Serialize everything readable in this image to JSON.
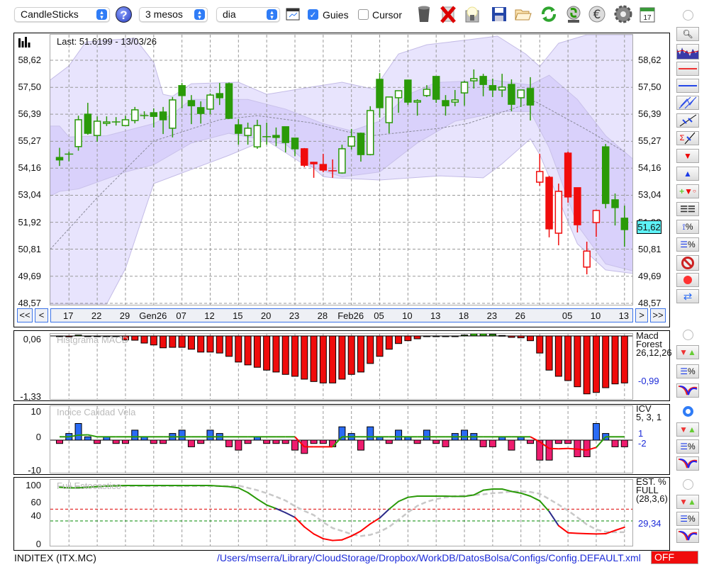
{
  "toolbar": {
    "chart_type": "CandleSticks",
    "help": "?",
    "period": "3 mesos",
    "interval": "dia",
    "guides_label": "Guies",
    "guides_checked": true,
    "cursor_label": "Cursor",
    "cursor_checked": false,
    "icons": [
      "chart-settings-icon",
      "trash-icon",
      "delete-icon",
      "lamp-icon",
      "save-icon",
      "folder-icon",
      "refresh-icon",
      "recycle-icon",
      "euro-icon",
      "gear-icon",
      "calendar-icon"
    ],
    "calendar_day": "17"
  },
  "main": {
    "last_label": "Last: 51.6199 - 13/03/26",
    "current_price": "51,62",
    "nav": {
      "first": "<<",
      "prev": "<",
      "next": ">",
      "last": ">>"
    }
  },
  "panels": {
    "macd": {
      "title": "Histgrama MACD",
      "name1": "Macd",
      "name2": "Forest",
      "name3": "26,12,26",
      "value": "-0,99",
      "ymax": "0,06",
      "ymin": "-1,33"
    },
    "icv": {
      "title": "Indice Calidad Vela",
      "name1": "ICV",
      "name2": "5, 3, 1",
      "value1": "1",
      "value2": "-2",
      "ymax": "10",
      "yzero": "0",
      "ymin": "-10"
    },
    "stoch": {
      "title": "Full Estocastico",
      "name1": "EST. %",
      "name2": "FULL",
      "name3": "(28,3,6)",
      "value": "29,34",
      "y100": "100",
      "y60": "60",
      "y40": "40",
      "y0": "0"
    }
  },
  "status": {
    "symbol": "INDITEX (ITX.MC)",
    "path": "/Users/mserra/Library/CloudStorage/Dropbox/WorkDB/DatosBolsa/Configs/Config.DEFAULT.xml",
    "toggle": "OFF"
  },
  "colors": {
    "up": "#2a9a08",
    "down_red": "#f00c0c",
    "macd_neg": "#f00c0c",
    "macd_pos": "#2a9a08",
    "icv_pos": "#2a6bf5",
    "icv_neg": "#ee1c6e",
    "accent": "#2f7cf6",
    "price_box": "#5ef2f6",
    "path": "#1c2bd8"
  },
  "chart_data": {
    "main": {
      "type": "candlestick",
      "ylim": [
        48.57,
        58.62
      ],
      "y_ticks": [
        {
          "v": 58.62,
          "label": "58,62"
        },
        {
          "v": 57.5,
          "label": "57,50"
        },
        {
          "v": 56.39,
          "label": "56,39"
        },
        {
          "v": 55.27,
          "label": "55,27"
        },
        {
          "v": 54.16,
          "label": "54,16"
        },
        {
          "v": 53.04,
          "label": "53,04"
        },
        {
          "v": 51.92,
          "label": "51,92"
        },
        {
          "v": 50.81,
          "label": "50,81"
        },
        {
          "v": 49.69,
          "label": "49,69"
        },
        {
          "v": 48.57,
          "label": "48,57"
        }
      ],
      "x_labels": [
        {
          "i": 1,
          "label": "17"
        },
        {
          "i": 4,
          "label": "22"
        },
        {
          "i": 7,
          "label": "29"
        },
        {
          "i": 10,
          "label": "Gen26"
        },
        {
          "i": 13,
          "label": "07"
        },
        {
          "i": 16,
          "label": "12"
        },
        {
          "i": 19,
          "label": "15"
        },
        {
          "i": 22,
          "label": "20"
        },
        {
          "i": 25,
          "label": "23"
        },
        {
          "i": 28,
          "label": "28"
        },
        {
          "i": 31,
          "label": "Feb26"
        },
        {
          "i": 34,
          "label": "05"
        },
        {
          "i": 37,
          "label": "10"
        },
        {
          "i": 40,
          "label": "13"
        },
        {
          "i": 43,
          "label": "18"
        },
        {
          "i": 46,
          "label": "23"
        },
        {
          "i": 49,
          "label": "26"
        },
        {
          "i": 54,
          "label": "05"
        },
        {
          "i": 57,
          "label": "10"
        },
        {
          "i": 60,
          "label": "13"
        }
      ],
      "grid_x": [
        1,
        4,
        7,
        10,
        13,
        16,
        19,
        22,
        25,
        28,
        31,
        34,
        37,
        40,
        43,
        46,
        49,
        51,
        54,
        57,
        60
      ],
      "candles_ohlc_color": [
        [
          54.6,
          55.0,
          54.25,
          54.5,
          "g"
        ],
        [
          54.74,
          54.84,
          54.44,
          54.74,
          "g"
        ],
        [
          55.05,
          56.33,
          54.88,
          56.16,
          "g"
        ],
        [
          56.39,
          56.86,
          55.54,
          55.6,
          "g"
        ],
        [
          55.51,
          56.3,
          55.25,
          56.1,
          "g"
        ],
        [
          56.01,
          56.3,
          55.9,
          56.07,
          "g"
        ],
        [
          56.07,
          56.27,
          55.92,
          56.07,
          "g"
        ],
        [
          55.92,
          56.33,
          55.92,
          56.16,
          "g"
        ],
        [
          56.13,
          56.69,
          56.01,
          56.57,
          "g"
        ],
        [
          56.33,
          56.51,
          56.19,
          56.33,
          "g"
        ],
        [
          56.45,
          56.63,
          55.84,
          56.3,
          "g"
        ],
        [
          56.48,
          56.69,
          55.57,
          56.16,
          "g"
        ],
        [
          55.81,
          57.1,
          55.43,
          56.98,
          "g"
        ],
        [
          57.57,
          57.68,
          56.63,
          57.16,
          "g"
        ],
        [
          56.95,
          57.18,
          55.98,
          56.74,
          "g"
        ],
        [
          56.66,
          56.92,
          56.0,
          56.42,
          "g"
        ],
        [
          56.6,
          57.25,
          56.39,
          57.18,
          "g"
        ],
        [
          57.24,
          57.68,
          56.77,
          57.07,
          "g"
        ],
        [
          57.65,
          57.7,
          56.19,
          56.22,
          "g"
        ],
        [
          55.95,
          56.19,
          55.13,
          55.6,
          "g"
        ],
        [
          55.51,
          56.04,
          55.13,
          55.81,
          "g"
        ],
        [
          55.04,
          56.16,
          54.96,
          55.92,
          "g"
        ],
        [
          55.46,
          56.04,
          55.13,
          55.46,
          "g"
        ],
        [
          55.51,
          55.84,
          55.07,
          55.43,
          "g"
        ],
        [
          55.87,
          55.87,
          54.81,
          55.22,
          "g"
        ],
        [
          55.4,
          55.4,
          54.66,
          54.96,
          "g"
        ],
        [
          54.96,
          54.99,
          54.2,
          54.28,
          "r"
        ],
        [
          54.4,
          54.42,
          53.76,
          54.35,
          "r"
        ],
        [
          54.31,
          54.75,
          53.99,
          54.08,
          "r"
        ],
        [
          54.05,
          54.52,
          53.76,
          54.05,
          "r"
        ],
        [
          53.96,
          55.13,
          53.93,
          54.96,
          "g"
        ],
        [
          55.07,
          55.78,
          54.93,
          55.46,
          "g"
        ],
        [
          55.6,
          55.63,
          54.43,
          54.72,
          "g"
        ],
        [
          54.72,
          56.72,
          54.69,
          56.54,
          "g"
        ],
        [
          57.83,
          58.09,
          56.25,
          56.66,
          "g"
        ],
        [
          56.04,
          57.1,
          55.6,
          57.1,
          "g"
        ],
        [
          57.07,
          57.36,
          56.45,
          57.36,
          "g"
        ],
        [
          57.8,
          57.8,
          56.77,
          56.89,
          "g"
        ],
        [
          56.89,
          57.01,
          56.33,
          56.95,
          "g"
        ],
        [
          57.16,
          57.59,
          57.1,
          57.42,
          "g"
        ],
        [
          57.95,
          57.95,
          56.86,
          57.01,
          "g"
        ],
        [
          56.95,
          57.18,
          56.33,
          56.74,
          "g"
        ],
        [
          56.89,
          57.39,
          56.72,
          56.98,
          "g"
        ],
        [
          57.27,
          57.77,
          56.74,
          57.71,
          "g"
        ],
        [
          57.77,
          58.24,
          57.45,
          57.86,
          "g"
        ],
        [
          57.95,
          58.06,
          57.13,
          57.62,
          "g"
        ],
        [
          57.57,
          57.86,
          57.1,
          57.39,
          "g"
        ],
        [
          57.39,
          58.06,
          57.1,
          57.51,
          "g"
        ],
        [
          57.62,
          57.83,
          56.51,
          56.8,
          "g"
        ],
        [
          57.07,
          57.39,
          56.69,
          57.39,
          "g"
        ],
        [
          57.45,
          57.92,
          56.13,
          56.77,
          "g"
        ],
        [
          53.58,
          54.75,
          53.43,
          54.02,
          "r"
        ],
        [
          53.78,
          53.84,
          51.3,
          51.65,
          "r"
        ],
        [
          51.47,
          53.52,
          50.97,
          53.2,
          "r"
        ],
        [
          54.78,
          54.84,
          52.73,
          52.97,
          "r"
        ],
        [
          53.35,
          53.35,
          51.5,
          51.82,
          "r"
        ],
        [
          50.07,
          51.12,
          49.77,
          50.73,
          "r"
        ],
        [
          51.91,
          52.44,
          51.32,
          52.41,
          "r"
        ],
        [
          55.04,
          55.16,
          52.5,
          52.7,
          "g"
        ],
        [
          52.85,
          53.11,
          51.79,
          52.53,
          "g"
        ],
        [
          52.09,
          52.61,
          50.91,
          51.62,
          "g"
        ]
      ],
      "outer_band_upper": [
        [
          -1,
          57.8
        ],
        [
          1,
          58.39
        ],
        [
          2.8,
          59.38
        ],
        [
          8,
          59.53
        ],
        [
          10,
          58.53
        ],
        [
          11,
          57.21
        ],
        [
          12,
          57.13
        ],
        [
          14,
          57.65
        ],
        [
          19,
          57.71
        ],
        [
          22,
          57.21
        ],
        [
          26.7,
          57.51
        ],
        [
          30,
          57.71
        ],
        [
          33.4,
          57.42
        ],
        [
          36,
          58.88
        ],
        [
          39,
          59.26
        ],
        [
          43.5,
          59.47
        ],
        [
          46.5,
          59.62
        ],
        [
          49.5,
          58.88
        ],
        [
          51,
          58.36
        ],
        [
          53,
          59.32
        ],
        [
          56,
          59.67
        ],
        [
          61,
          59.67
        ]
      ],
      "outer_band_lower": [
        [
          -1,
          48.54
        ],
        [
          5,
          48.54
        ],
        [
          7,
          50.01
        ],
        [
          10,
          53.52
        ],
        [
          13,
          53.96
        ],
        [
          18,
          54.69
        ],
        [
          21.6,
          55.28
        ],
        [
          24,
          55.16
        ],
        [
          28,
          53.81
        ],
        [
          29,
          53.76
        ],
        [
          34,
          53.67
        ],
        [
          40.4,
          53.84
        ],
        [
          45,
          53.76
        ],
        [
          47,
          54.34
        ],
        [
          50,
          55.37
        ],
        [
          51,
          54.72
        ],
        [
          55,
          51.03
        ],
        [
          58,
          49.95
        ],
        [
          61,
          49.8
        ]
      ],
      "inner_band_upper": [
        [
          -1,
          55.9
        ],
        [
          0,
          55.9
        ],
        [
          1,
          55.45
        ],
        [
          5,
          55.5
        ],
        [
          10,
          56.0
        ],
        [
          12,
          56.4
        ],
        [
          14,
          57.0
        ],
        [
          20,
          57.0
        ],
        [
          24,
          56.6
        ],
        [
          28,
          56.0
        ],
        [
          31,
          55.7
        ],
        [
          34,
          56.1
        ],
        [
          37,
          57.2
        ],
        [
          40,
          57.7
        ],
        [
          46,
          57.8
        ],
        [
          50,
          57.6
        ],
        [
          52,
          58.0
        ],
        [
          55,
          57.0
        ],
        [
          58,
          55.5
        ],
        [
          61,
          54.5
        ]
      ],
      "inner_band_lower": [
        [
          -1,
          53.0
        ],
        [
          0,
          53.2
        ],
        [
          2,
          53.3
        ],
        [
          7,
          54.0
        ],
        [
          10,
          54.3
        ],
        [
          14,
          55.2
        ],
        [
          18,
          55.6
        ],
        [
          22,
          55.3
        ],
        [
          26,
          54.3
        ],
        [
          30,
          53.8
        ],
        [
          34,
          54.0
        ],
        [
          38,
          55.2
        ],
        [
          42,
          56.1
        ],
        [
          47,
          56.5
        ],
        [
          50,
          56.5
        ],
        [
          52,
          55.0
        ],
        [
          55,
          51.8
        ],
        [
          58,
          50.2
        ],
        [
          61,
          49.9
        ]
      ],
      "sma": [
        [
          -1,
          50.8
        ],
        [
          4,
          52.94
        ],
        [
          10,
          55.28
        ],
        [
          17,
          56.16
        ],
        [
          21,
          56.33
        ],
        [
          26.6,
          56.04
        ],
        [
          30.6,
          55.66
        ],
        [
          33.4,
          55.51
        ],
        [
          40.4,
          55.81
        ],
        [
          43.4,
          56.01
        ],
        [
          50.5,
          56.92
        ],
        [
          55.7,
          55.81
        ],
        [
          60,
          54.84
        ]
      ]
    },
    "macd": {
      "type": "bar",
      "ylim": [
        -1.33,
        0.06
      ],
      "values": [
        -0.005,
        -0.02,
        0.02,
        0,
        0,
        -0.005,
        -0.01,
        -0.085,
        -0.09,
        -0.15,
        -0.19,
        -0.25,
        -0.24,
        -0.24,
        -0.28,
        -0.34,
        -0.34,
        -0.36,
        -0.43,
        -0.55,
        -0.61,
        -0.66,
        -0.72,
        -0.76,
        -0.81,
        -0.85,
        -0.91,
        -0.96,
        -0.99,
        -0.99,
        -0.91,
        -0.81,
        -0.76,
        -0.58,
        -0.43,
        -0.28,
        -0.16,
        -0.1,
        -0.06,
        0,
        -0.005,
        -0.01,
        -0.01,
        0.02,
        0.06,
        0.06,
        0.04,
        0.01,
        -0.03,
        -0.04,
        -0.1,
        -0.36,
        -0.72,
        -0.85,
        -0.94,
        -1.07,
        -1.22,
        -1.19,
        -1.09,
        -1.01,
        -0.99
      ]
    },
    "icv": {
      "type": "bar",
      "ylim": [
        -10,
        10
      ],
      "values": [
        -1,
        2,
        5,
        1,
        -1,
        1,
        -1,
        -1,
        3,
        1,
        -1,
        -1,
        2,
        3,
        -2,
        -1,
        3,
        2,
        -2,
        -3,
        -1,
        1,
        -1,
        -1,
        -1,
        -3,
        -4,
        -1,
        -1,
        -2,
        4,
        2,
        -3,
        4,
        1,
        -1,
        3,
        1,
        -1,
        3,
        -1,
        -2,
        2,
        3,
        2,
        -2,
        -2,
        1,
        -3,
        1,
        -1,
        -6,
        -6,
        -1,
        -1,
        -5,
        -5,
        5,
        2,
        -2,
        -2
      ],
      "signal": [
        1,
        1,
        1.5,
        1.6,
        1,
        1,
        1,
        1,
        1,
        1,
        1,
        1,
        1,
        1,
        1,
        1,
        1,
        1,
        1,
        1,
        1,
        1,
        1,
        1,
        1,
        1,
        -2,
        -2,
        -2,
        -2,
        1,
        1,
        1,
        1,
        1,
        1,
        1,
        1,
        1,
        1,
        1,
        1,
        1,
        1,
        1,
        1,
        1,
        1,
        1,
        1,
        1,
        -0.5,
        -2.5,
        -2.6,
        -2.5,
        -2.7,
        -3,
        -2.2,
        1,
        1,
        1
      ]
    },
    "stoch": {
      "type": "line",
      "ylim": [
        0,
        100
      ],
      "levels": [
        60,
        40
      ],
      "k": [
        97,
        96,
        96,
        97,
        98,
        99,
        99.6,
        100,
        100,
        100,
        100,
        100,
        100,
        100,
        100,
        100,
        100,
        99,
        98,
        96,
        88,
        77,
        67,
        61,
        54,
        46,
        30,
        18,
        10,
        7,
        8,
        14.5,
        23,
        35,
        45,
        60,
        73,
        80,
        82,
        82,
        82,
        82,
        81.5,
        81.5,
        84,
        92,
        94,
        94,
        90,
        87,
        82,
        74,
        56,
        32,
        20,
        19,
        18.4,
        18,
        18.4,
        24,
        29.34
      ],
      "d": [
        98,
        98,
        98,
        98,
        98,
        99,
        99,
        99,
        99,
        99,
        99,
        99,
        99,
        99,
        99,
        99,
        99,
        99,
        99,
        100,
        96,
        92,
        87,
        81,
        74.5,
        65,
        57,
        50,
        38,
        28,
        23,
        17.6,
        14.5,
        16.5,
        21.6,
        30,
        42,
        54.5,
        65.5,
        72.5,
        77,
        80,
        82,
        83,
        84,
        85,
        87,
        88,
        90,
        90,
        89,
        86,
        77,
        67.5,
        57.6,
        46,
        34,
        25.5,
        21.6,
        21,
        21
      ]
    }
  }
}
